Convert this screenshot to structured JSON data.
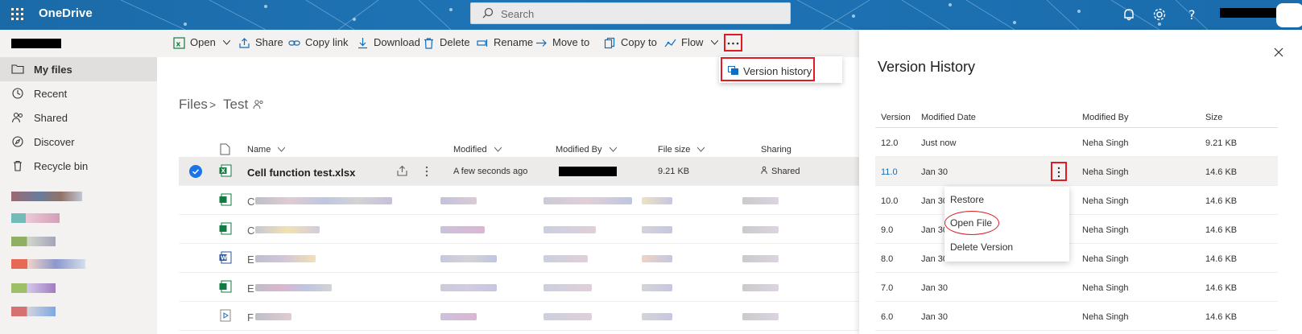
{
  "app": {
    "title": "OneDrive"
  },
  "search": {
    "placeholder": "Search"
  },
  "nav": {
    "items": [
      {
        "label": "My files",
        "icon": "folder-icon",
        "active": true
      },
      {
        "label": "Recent",
        "icon": "clock-icon"
      },
      {
        "label": "Shared",
        "icon": "people-icon"
      },
      {
        "label": "Discover",
        "icon": "compass-icon"
      },
      {
        "label": "Recycle bin",
        "icon": "trash-icon"
      }
    ]
  },
  "toolbar": {
    "open": "Open",
    "share": "Share",
    "copy_link": "Copy link",
    "download": "Download",
    "delete": "Delete",
    "rename": "Rename",
    "move_to": "Move to",
    "copy_to": "Copy to",
    "flow": "Flow",
    "more": "..."
  },
  "more_menu": {
    "version_history": "Version history"
  },
  "breadcrumb": {
    "root": "Files",
    "separator": ">",
    "current": "Test"
  },
  "files": {
    "headers": {
      "name": "Name",
      "modified": "Modified",
      "modified_by": "Modified By",
      "file_size": "File size",
      "sharing": "Sharing"
    },
    "selected_row": {
      "name": "Cell function test.xlsx",
      "modified": "A few seconds ago",
      "file_size": "9.21 KB",
      "sharing": "Shared"
    },
    "row_prefixes": [
      "C",
      "C",
      "E",
      "E",
      "F"
    ]
  },
  "version_panel": {
    "title": "Version History",
    "headers": {
      "version": "Version",
      "modified_date": "Modified Date",
      "modified_by": "Modified By",
      "size": "Size"
    },
    "rows": [
      {
        "version": "12.0",
        "date": "Just now",
        "by": "Neha Singh",
        "size": "9.21 KB"
      },
      {
        "version": "11.0",
        "date": "Jan 30",
        "by": "Neha Singh",
        "size": "14.6 KB"
      },
      {
        "version": "10.0",
        "date": "Jan 30",
        "by": "Neha Singh",
        "size": "14.6 KB"
      },
      {
        "version": "9.0",
        "date": "Jan 30",
        "by": "Neha Singh",
        "size": "14.6 KB"
      },
      {
        "version": "8.0",
        "date": "Jan 30",
        "by": "Neha Singh",
        "size": "14.6 KB"
      },
      {
        "version": "7.0",
        "date": "Jan 30",
        "by": "Neha Singh",
        "size": "14.6 KB"
      },
      {
        "version": "6.0",
        "date": "Jan 30",
        "by": "Neha Singh",
        "size": "14.6 KB"
      }
    ]
  },
  "context_menu": {
    "restore": "Restore",
    "open_file": "Open File",
    "delete_version": "Delete Version"
  },
  "colors": {
    "brand": "#1b6aa8",
    "highlight": "#e01b24",
    "link": "#106ebe",
    "excel": "#107c41",
    "word": "#2b579a"
  }
}
